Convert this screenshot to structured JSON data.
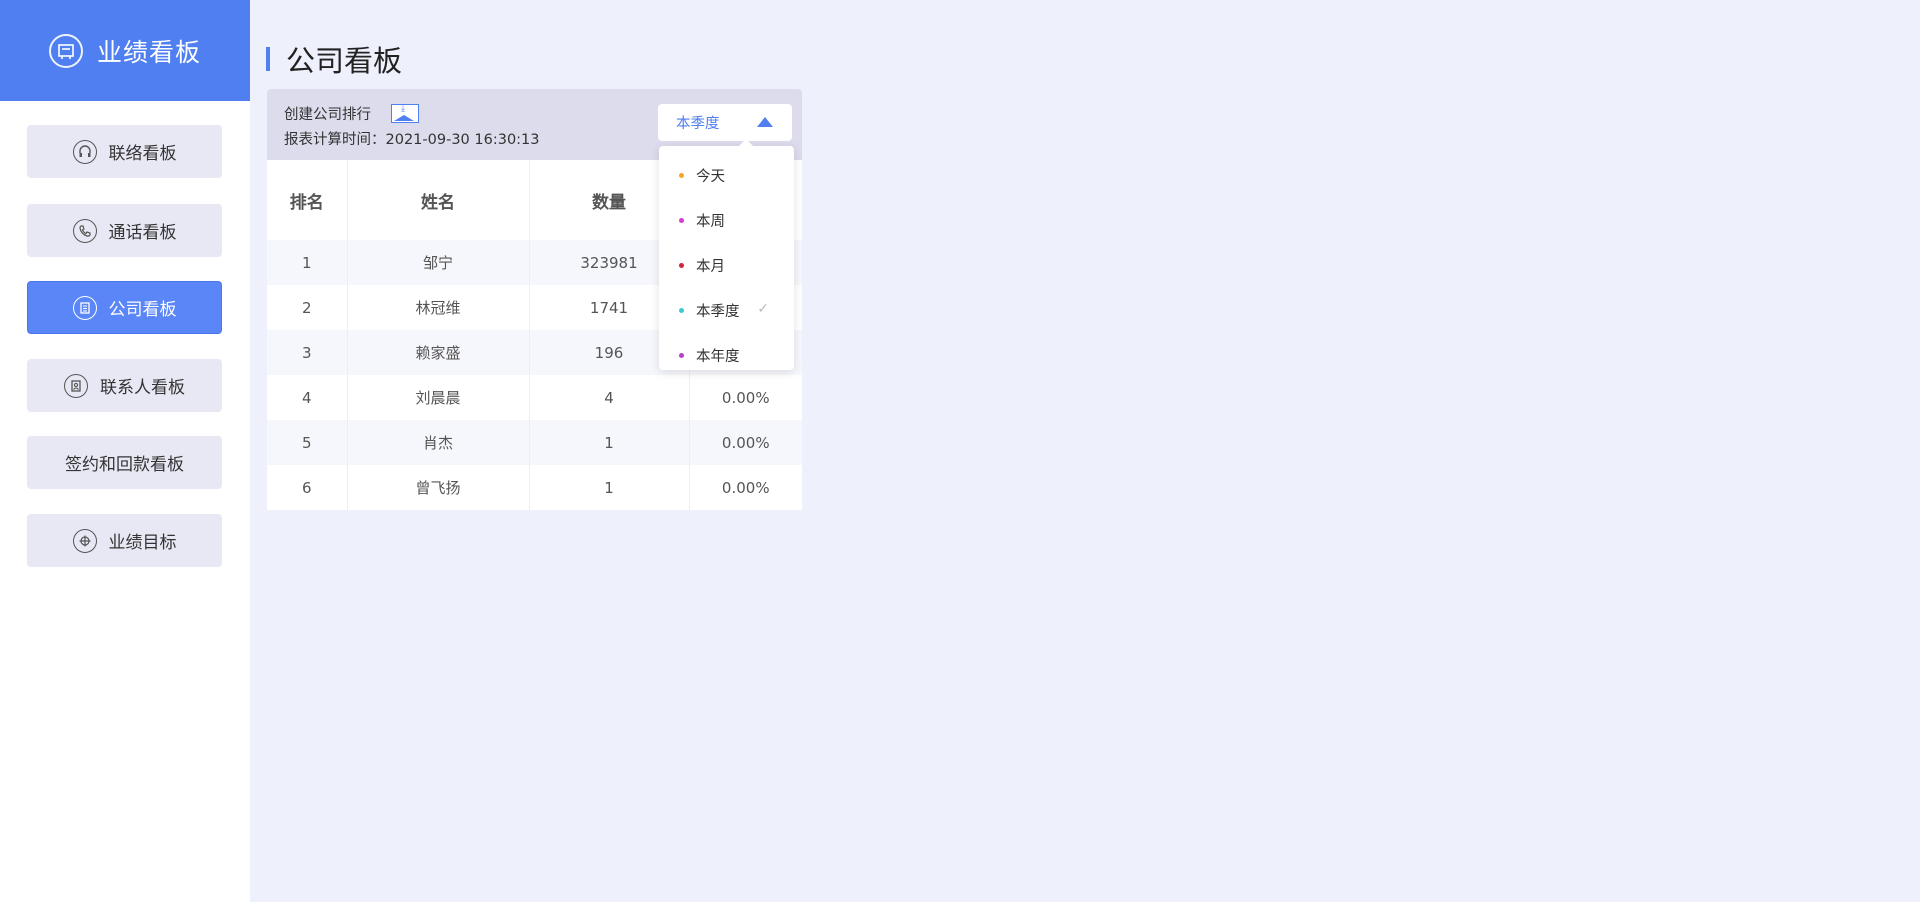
{
  "sidebar": {
    "title": "业绩看板",
    "items": [
      {
        "label": "联络看板",
        "icon": "headset-icon"
      },
      {
        "label": "通话看板",
        "icon": "phone-icon"
      },
      {
        "label": "公司看板",
        "icon": "building-icon",
        "active": true
      },
      {
        "label": "联系人看板",
        "icon": "contact-icon"
      },
      {
        "label": "签约和回款看板"
      },
      {
        "label": "业绩目标",
        "icon": "target-icon"
      }
    ]
  },
  "page": {
    "title": "公司看板"
  },
  "panel": {
    "label": "创建公司排行",
    "export_icon": "image-download-icon",
    "time_label": "报表计算时间：",
    "time_value": "2021-09-30 16:30:13",
    "select_value": "本季度"
  },
  "table": {
    "headers": [
      "排名",
      "姓名",
      "数量",
      ""
    ],
    "rows": [
      [
        "1",
        "邹宁",
        "323981",
        ""
      ],
      [
        "2",
        "林冠维",
        "1741",
        ""
      ],
      [
        "3",
        "赖家盛",
        "196",
        ""
      ],
      [
        "4",
        "刘晨晨",
        "4",
        "0.00%"
      ],
      [
        "5",
        "肖杰",
        "1",
        "0.00%"
      ],
      [
        "6",
        "曾飞扬",
        "1",
        "0.00%"
      ]
    ]
  },
  "dropdown": {
    "items": [
      {
        "label": "今天",
        "color": "#f5a623"
      },
      {
        "label": "本周",
        "color": "#d63bd6"
      },
      {
        "label": "本月",
        "color": "#d0253c"
      },
      {
        "label": "本季度",
        "color": "#3bc9db",
        "selected": true,
        "check": "✓"
      },
      {
        "label": "本年度",
        "color": "#b640c9"
      }
    ]
  },
  "colors": {
    "primary": "#4f7ff0",
    "background": "#eef0fb"
  }
}
